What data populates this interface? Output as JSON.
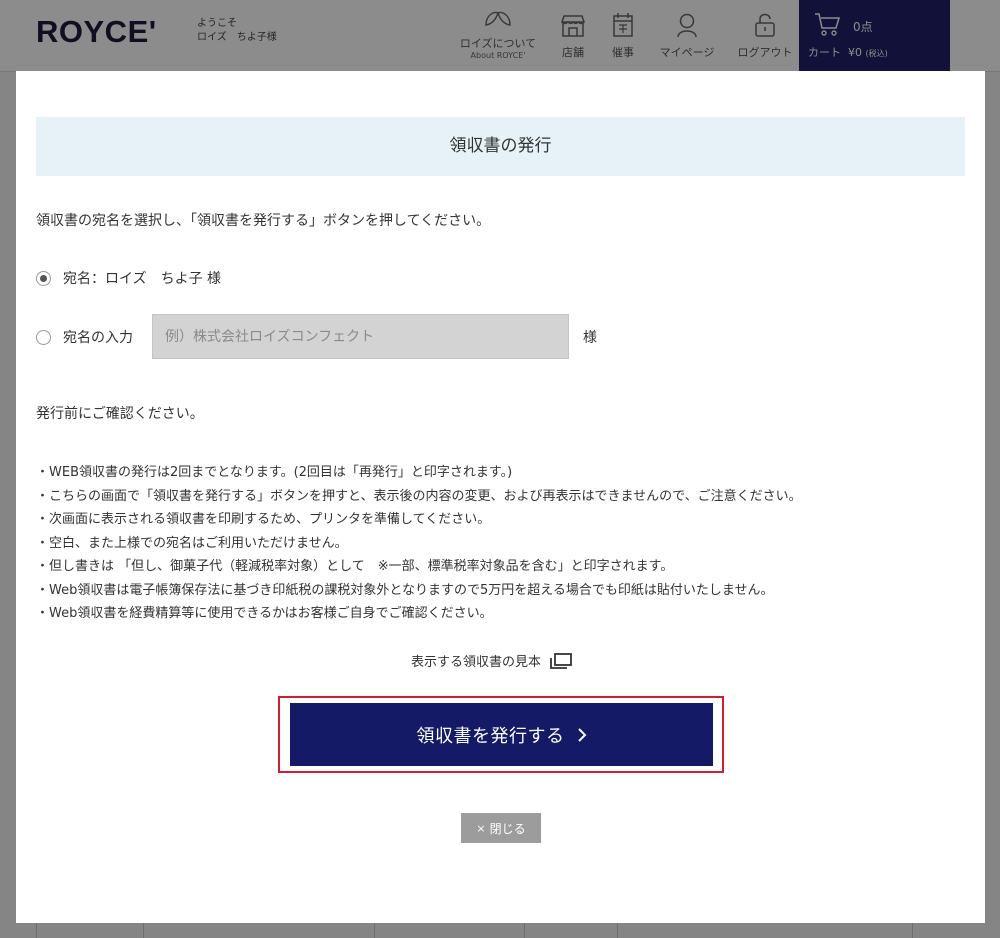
{
  "header": {
    "logo": "ROYCE'",
    "welcome_line1": "ようこそ",
    "welcome_line2": "ロイズ　ちよ子様",
    "nav": {
      "about": "ロイズについて",
      "about_sub": "About ROYCE'",
      "stores": "店舗",
      "events": "催事",
      "mypage": "マイページ",
      "logout": "ログアウト"
    },
    "cart": {
      "count": "0点",
      "label": "カート",
      "amount": "¥0",
      "tax": "(税込)"
    }
  },
  "modal": {
    "title": "領収書の発行",
    "instruction": "領収書の宛名を選択し、「領収書を発行する」ボタンを押してください。",
    "option_default": "宛名：ロイズ　ちよ子 様",
    "option_custom": "宛名の入力",
    "custom_placeholder": "例）株式会社ロイズコンフェクト",
    "custom_value": "",
    "honorific": "様",
    "confirm_heading": "発行前にご確認ください。",
    "notes": [
      "・WEB領収書の発行は2回までとなります。(2回目は「再発行」と印字されます。)",
      "・こちらの画面で「領収書を発行する」ボタンを押すと、表示後の内容の変更、および再表示はできませんので、ご注意ください。",
      "・次画面に表示される領収書を印刷するため、プリンタを準備してください。",
      "・空白、また上様での宛名はご利用いただけません。",
      "・但し書きは 「但し、御菓子代（軽減税率対象）として　※一部、標準税率対象品を含む」と印字されます。",
      "・Web領収書は電子帳簿保存法に基づき印紙税の課税対象外となりますので5万円を超える場合でも印紙は貼付いたしません。",
      "・Web領収書を経費精算等に使用できるかはお客様ご自身でご確認ください。"
    ],
    "sample_link": "表示する領収書の見本",
    "issue_button": "領収書を発行する",
    "close_button": "閉じる"
  },
  "colors": {
    "brand_navy": "#141a66",
    "highlight_red": "#cc1f2f",
    "title_bg": "#e7f2f8"
  },
  "icons": [
    "leaf-icon",
    "store-icon",
    "calendar-icon",
    "user-icon",
    "lock-icon",
    "cart-icon",
    "new-window-icon",
    "chevron-right-icon",
    "close-icon"
  ]
}
